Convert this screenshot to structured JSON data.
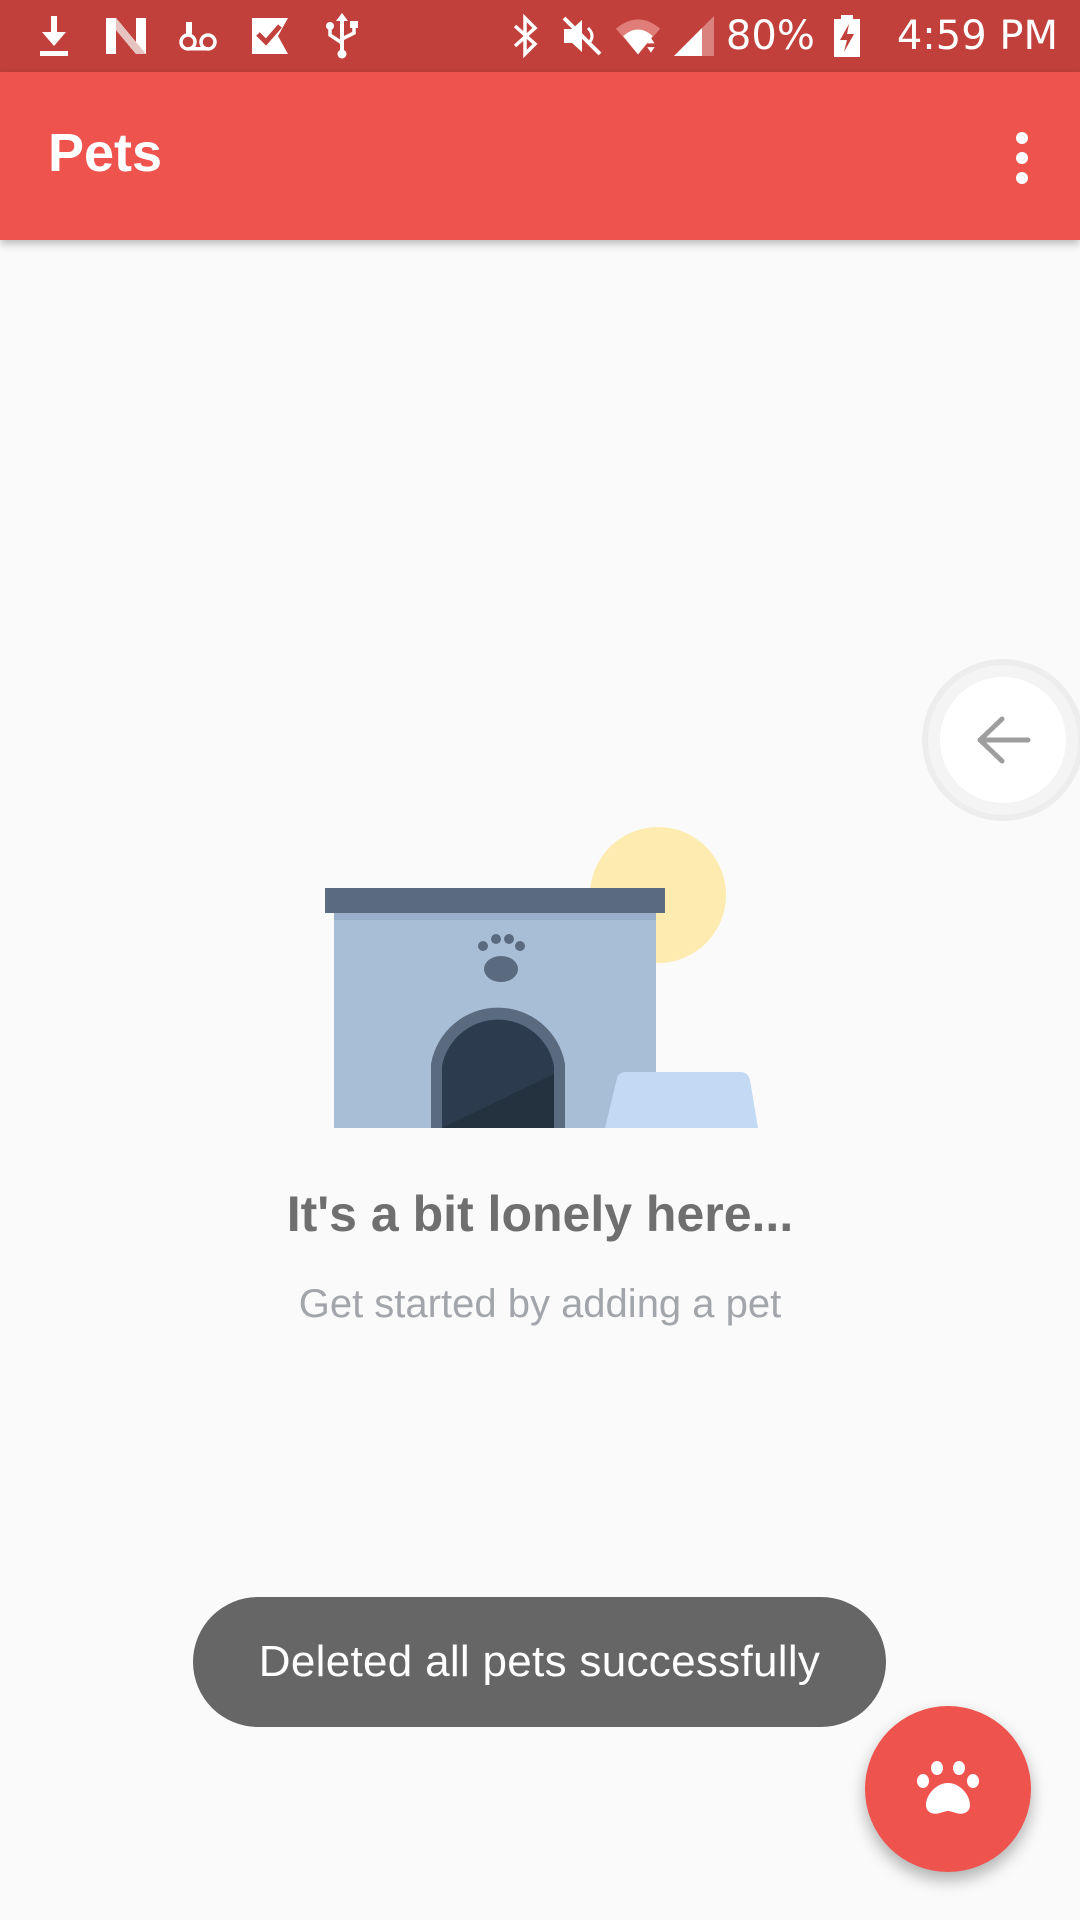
{
  "status_bar": {
    "battery_percent": "80%",
    "time": "4:59 PM",
    "left_icons": [
      "download-icon",
      "n-icon",
      "voicemail-icon",
      "check-flag-icon",
      "usb-icon"
    ],
    "right_icons": [
      "bluetooth-icon",
      "mute-icon",
      "wifi-icon",
      "signal-icon",
      "battery-charging-icon"
    ]
  },
  "app_bar": {
    "title": "Pets",
    "menu_icon": "overflow-menu-icon"
  },
  "empty_state": {
    "title": "It's a bit lonely here...",
    "subtitle": "Get started by adding a pet"
  },
  "toast": {
    "message": "Deleted all pets successfully"
  },
  "fab": {
    "icon": "paw-icon"
  },
  "edge_button": {
    "icon": "arrow-left-icon"
  },
  "colors": {
    "status_bar": "#c1403b",
    "app_bar": "#ef534e",
    "background": "#fafafa",
    "fab": "#ef534e",
    "toast": "#666666"
  }
}
